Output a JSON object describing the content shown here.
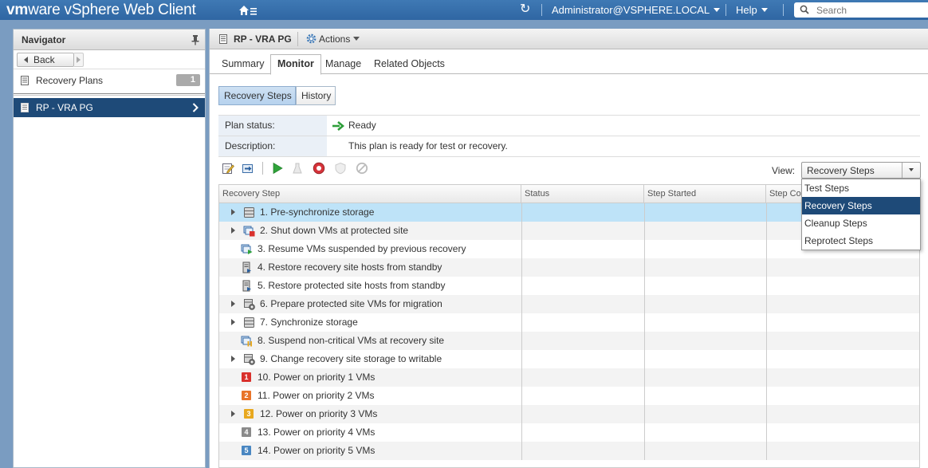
{
  "topbar": {
    "brand_vm": "vm",
    "brand_ware": "ware",
    "brand_product": " vSphere Web Client",
    "user": "Administrator@VSPHERE.LOCAL",
    "help": "Help",
    "search_placeholder": "Search"
  },
  "navigator": {
    "title": "Navigator",
    "back_label": "Back",
    "items": [
      {
        "label": "Recovery Plans",
        "count": "1"
      }
    ],
    "selected_item": "RP - VRA PG"
  },
  "object": {
    "title": "RP - VRA PG",
    "actions_label": "Actions"
  },
  "tabs": [
    {
      "label": "Summary"
    },
    {
      "label": "Monitor"
    },
    {
      "label": "Manage"
    },
    {
      "label": "Related Objects"
    }
  ],
  "subtabs": [
    {
      "label": "Recovery Steps"
    },
    {
      "label": "History"
    }
  ],
  "plan": {
    "status_label": "Plan status:",
    "status_value": "Ready",
    "description_label": "Description:",
    "description_value": "This plan is ready for test or recovery."
  },
  "view": {
    "label": "View:",
    "selected": "Recovery Steps",
    "options": [
      "Test Steps",
      "Recovery Steps",
      "Cleanup Steps",
      "Reprotect Steps"
    ]
  },
  "grid": {
    "columns": [
      "Recovery Step",
      "Status",
      "Step Started",
      "Step Completed"
    ],
    "rows": [
      {
        "text": "1. Pre-synchronize storage",
        "icon": "storage-icon",
        "expandable": true
      },
      {
        "text": "2. Shut down VMs at protected site",
        "icon": "shutdown-vms-icon",
        "expandable": true
      },
      {
        "text": "3. Resume VMs suspended by previous recovery",
        "icon": "resume-vms-icon",
        "expandable": false
      },
      {
        "text": "4. Restore recovery site hosts from standby",
        "icon": "host-standby-icon",
        "expandable": false
      },
      {
        "text": "5. Restore protected site hosts from standby",
        "icon": "host-standby-icon",
        "expandable": false
      },
      {
        "text": "6. Prepare protected site VMs for migration",
        "icon": "prepare-vms-icon",
        "expandable": true
      },
      {
        "text": "7. Synchronize storage",
        "icon": "storage-icon",
        "expandable": true
      },
      {
        "text": "8. Suspend non-critical VMs at recovery site",
        "icon": "suspend-vms-icon",
        "expandable": false
      },
      {
        "text": "9. Change recovery site storage to writable",
        "icon": "storage-writable-icon",
        "expandable": true
      },
      {
        "text": "10. Power on priority 1 VMs",
        "icon": "priority-1-icon",
        "badge": "1",
        "color": "#d9302c",
        "expandable": false
      },
      {
        "text": "11. Power on priority 2 VMs",
        "icon": "priority-2-icon",
        "badge": "2",
        "color": "#e8742a",
        "expandable": false
      },
      {
        "text": "12. Power on priority 3 VMs",
        "icon": "priority-3-icon",
        "badge": "3",
        "color": "#e8a81f",
        "expandable": true
      },
      {
        "text": "13. Power on priority 4 VMs",
        "icon": "priority-4-icon",
        "badge": "4",
        "color": "#8a8a8a",
        "expandable": false
      },
      {
        "text": "14. Power on priority 5 VMs",
        "icon": "priority-5-icon",
        "badge": "5",
        "color": "#4a87c2",
        "expandable": false
      }
    ]
  }
}
